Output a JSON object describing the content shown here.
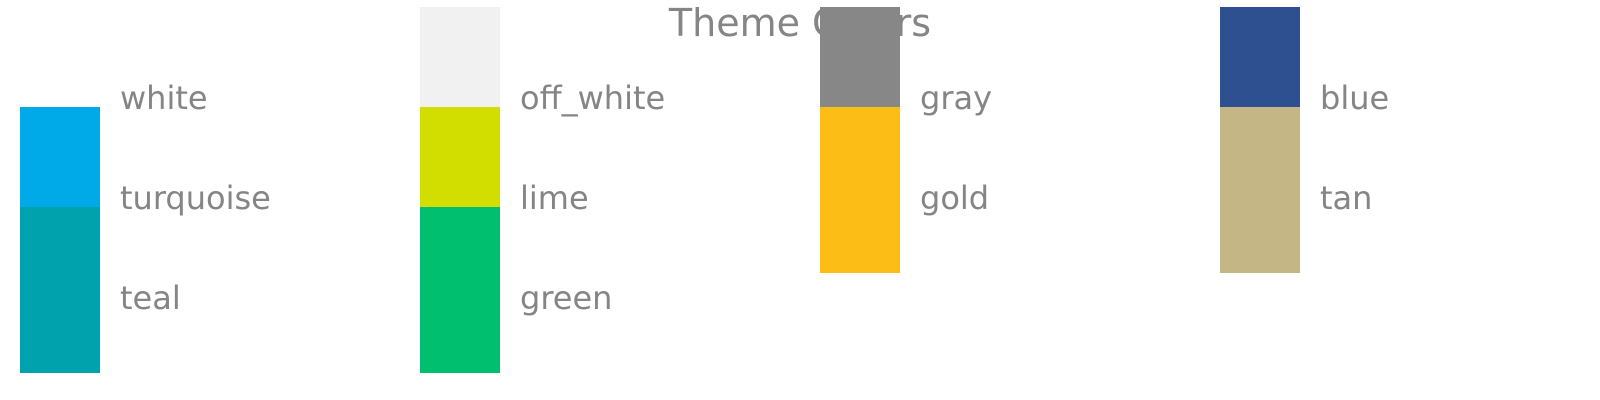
{
  "chart_data": {
    "type": "table",
    "title": "Theme Colors",
    "columns": [
      {
        "swatches": [
          {
            "name": "white",
            "color": "#FFFFFF"
          },
          {
            "name": "turquoise",
            "color": "#00A9E8"
          },
          {
            "name": "teal",
            "color": "#00A2AE"
          }
        ]
      },
      {
        "swatches": [
          {
            "name": "off_white",
            "color": "#F1F1F1"
          },
          {
            "name": "lime",
            "color": "#D2DE00"
          },
          {
            "name": "green",
            "color": "#00BF6F"
          }
        ]
      },
      {
        "swatches": [
          {
            "name": "gray",
            "color": "#878787"
          },
          {
            "name": "gold",
            "color": "#FBBD16"
          }
        ]
      },
      {
        "swatches": [
          {
            "name": "blue",
            "color": "#2E5090"
          },
          {
            "name": "tan",
            "color": "#C5B785"
          }
        ]
      }
    ]
  }
}
